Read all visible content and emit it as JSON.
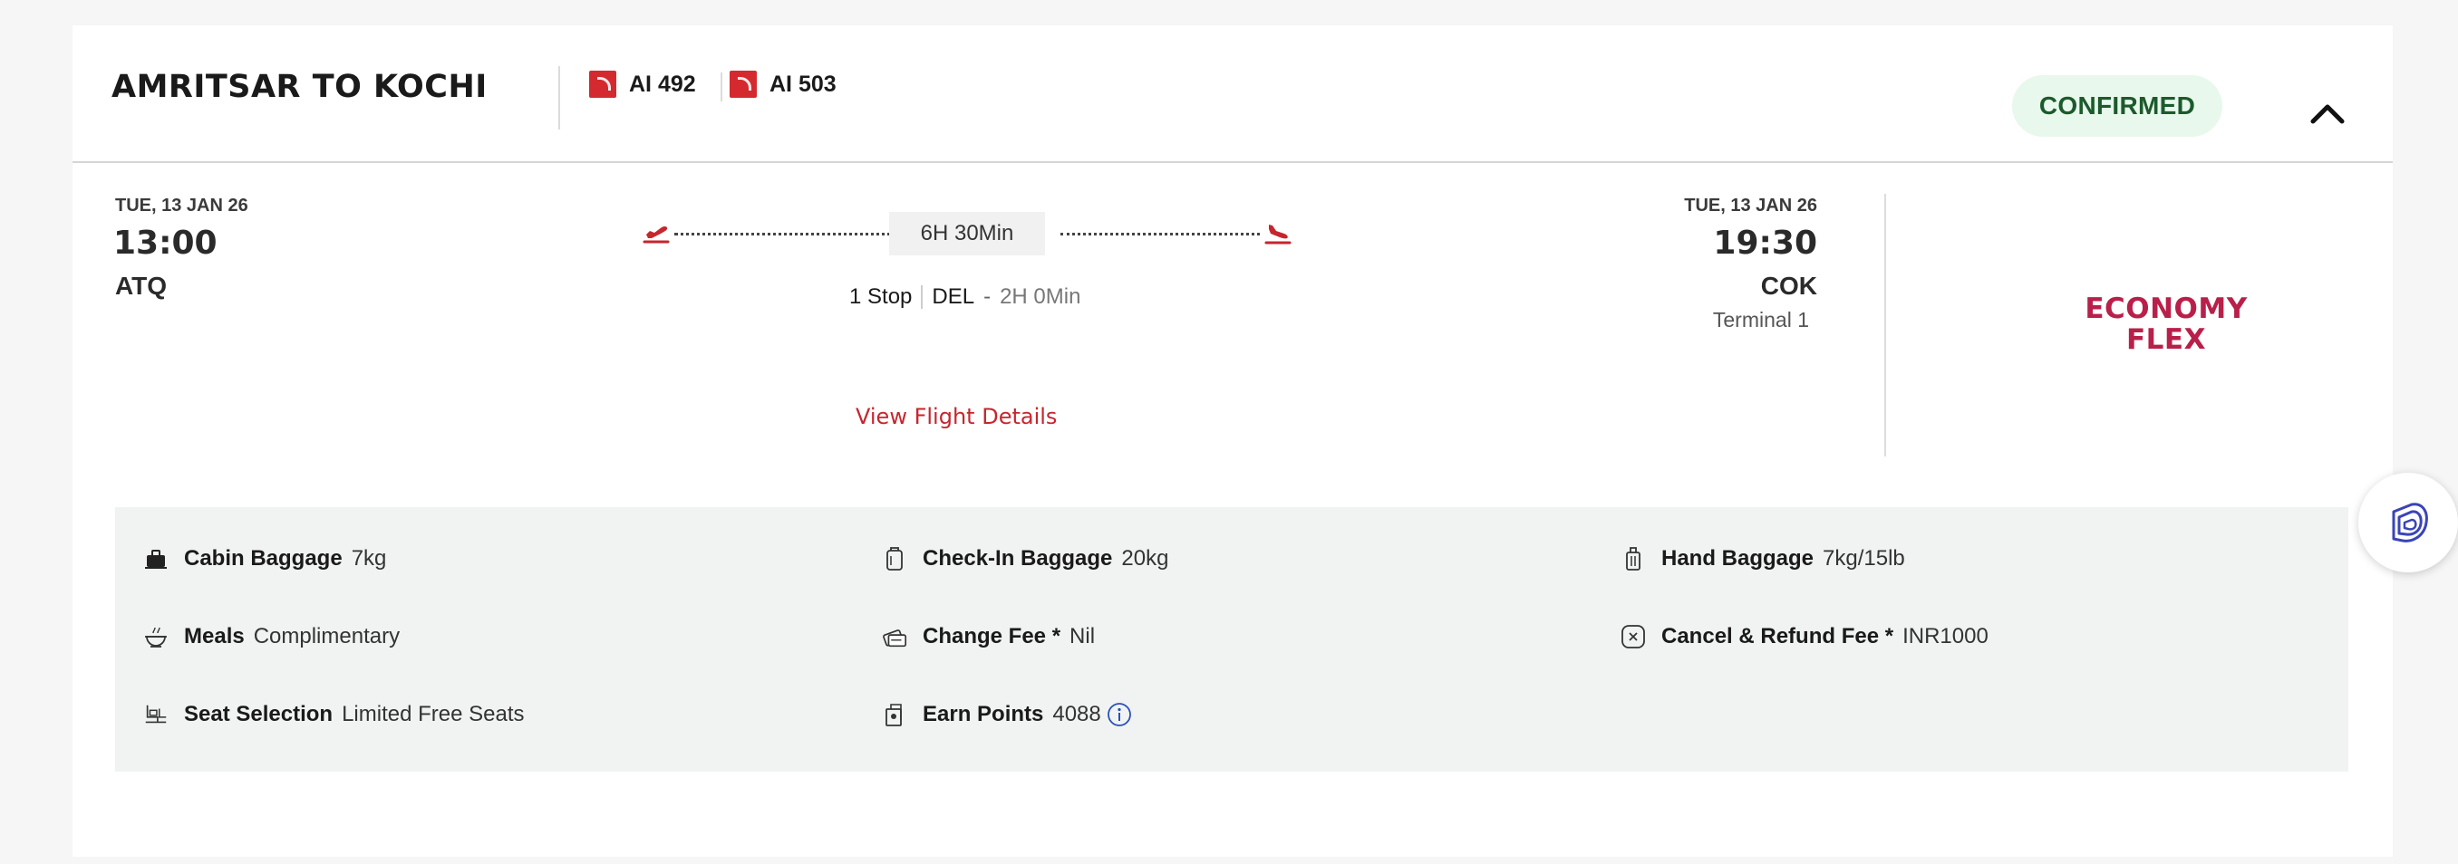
{
  "header": {
    "route_title": "AMRITSAR TO KOCHI",
    "flights": [
      {
        "number": "AI 492",
        "logo_icon": "air-india-logo-icon"
      },
      {
        "number": "AI 503",
        "logo_icon": "air-india-logo-icon"
      }
    ],
    "status": "CONFIRMED",
    "collapse_icon": "chevron-up-icon"
  },
  "departure": {
    "date": "TUE, 13 JAN 26",
    "time": "13:00",
    "code": "ATQ"
  },
  "route": {
    "duration": "6H 30Min",
    "stops": "1 Stop",
    "stop_code": "DEL",
    "stop_dash": "-",
    "layover": "2H 0Min",
    "view_details": "View Flight Details"
  },
  "arrival": {
    "date": "TUE, 13 JAN 26",
    "time": "19:30",
    "code": "COK",
    "terminal": "Terminal 1"
  },
  "fare": {
    "line1": "ECONOMY",
    "line2": "FLEX"
  },
  "benefits": [
    {
      "icon": "cabin-baggage-icon",
      "label": "Cabin Baggage",
      "value": "7kg"
    },
    {
      "icon": "check-in-baggage-icon",
      "label": "Check-In Baggage",
      "value": "20kg"
    },
    {
      "icon": "hand-baggage-icon",
      "label": "Hand Baggage",
      "value": "7kg/15lb"
    },
    {
      "icon": "meals-icon",
      "label": "Meals",
      "value": "Complimentary"
    },
    {
      "icon": "change-fee-icon",
      "label": "Change Fee *",
      "value": "Nil"
    },
    {
      "icon": "cancel-refund-icon",
      "label": "Cancel & Refund Fee *",
      "value": "INR1000"
    },
    {
      "icon": "seat-selection-icon",
      "label": "Seat Selection",
      "value": "Limited Free Seats"
    },
    {
      "icon": "earn-points-icon",
      "label": "Earn Points",
      "value": "4088"
    }
  ],
  "colors": {
    "accent_red": "#c6262e",
    "fare_color": "#b8204a",
    "status_bg": "#e8f8ec",
    "status_text": "#1c5a2c",
    "info_blue": "#2850b8"
  }
}
